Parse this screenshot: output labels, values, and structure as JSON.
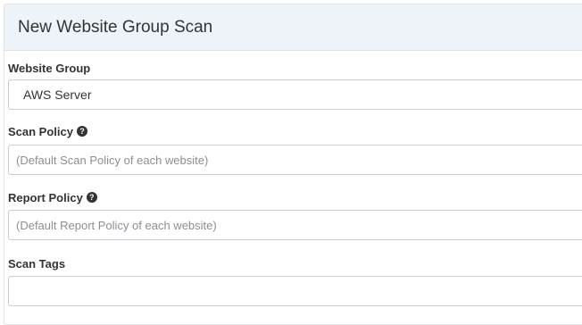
{
  "panel": {
    "title": "New Website Group Scan"
  },
  "form": {
    "website_group": {
      "label": "Website Group",
      "value": "AWS Server"
    },
    "scan_policy": {
      "label": "Scan Policy",
      "placeholder": "(Default Scan Policy of each website)",
      "help_icon": "question-circle-icon"
    },
    "report_policy": {
      "label": "Report Policy",
      "placeholder": "(Default Report Policy of each website)",
      "help_icon": "question-circle-icon"
    },
    "scan_tags": {
      "label": "Scan Tags",
      "value": ""
    }
  }
}
